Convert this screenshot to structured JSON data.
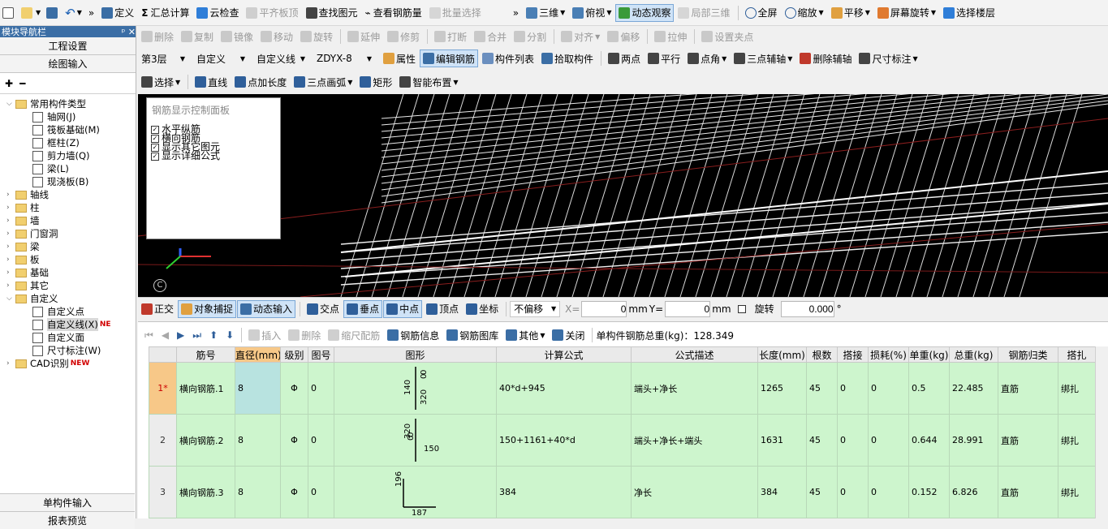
{
  "toolbar1": {
    "items": [
      {
        "label": "定义",
        "icon": "define-icon"
      },
      {
        "label": "汇总计算",
        "icon": "sigma-icon"
      },
      {
        "label": "云检查",
        "icon": "cloud-check-icon"
      },
      {
        "label": "平齐板顶",
        "icon": "align-slab-icon"
      },
      {
        "label": "查找图元",
        "icon": "binoculars-icon"
      },
      {
        "label": "查看钢筋量",
        "icon": "rebar-quantity-icon"
      },
      {
        "label": "批量选择",
        "icon": "batch-select-icon"
      }
    ],
    "right_items": [
      {
        "label": "三维",
        "icon": "3d-cube-icon"
      },
      {
        "label": "俯视",
        "icon": "top-view-icon"
      },
      {
        "label": "动态观察",
        "icon": "orbit-icon"
      },
      {
        "label": "局部三维",
        "icon": "local-3d-icon"
      },
      {
        "label": "全屏",
        "icon": "fullscreen-icon"
      },
      {
        "label": "缩放",
        "icon": "zoom-icon"
      },
      {
        "label": "平移",
        "icon": "pan-icon"
      },
      {
        "label": "屏幕旋转",
        "icon": "screen-rotate-icon"
      },
      {
        "label": "选择楼层",
        "icon": "floor-select-icon"
      }
    ]
  },
  "toolbar2": {
    "items": [
      "删除",
      "复制",
      "镜像",
      "移动",
      "旋转",
      "延伸",
      "修剪",
      "打断",
      "合并",
      "分割",
      "对齐",
      "偏移",
      "拉伸",
      "设置夹点"
    ]
  },
  "toolbar3": {
    "floor": "第3层",
    "type": "自定义",
    "subtype": "自定义线",
    "code": "ZDYX-8",
    "items": [
      "属性",
      "编辑钢筋",
      "构件列表",
      "拾取构件",
      "两点",
      "平行",
      "点角",
      "三点辅轴",
      "删除辅轴",
      "尺寸标注"
    ]
  },
  "toolbar4": {
    "items": [
      "选择",
      "直线",
      "点加长度",
      "三点画弧",
      "矩形",
      "智能布置"
    ]
  },
  "left_panel": {
    "title": "模块导航栏",
    "pin": "ᵖ ✕",
    "project_settings": "工程设置",
    "drawing_input": "绘图输入",
    "tree": [
      {
        "label": "常用构件类型",
        "level": 0,
        "kind": "folder",
        "expanded": true
      },
      {
        "label": "轴网(J)",
        "level": 1,
        "kind": "item"
      },
      {
        "label": "筏板基础(M)",
        "level": 1,
        "kind": "item"
      },
      {
        "label": "框柱(Z)",
        "level": 1,
        "kind": "item"
      },
      {
        "label": "剪力墙(Q)",
        "level": 1,
        "kind": "item"
      },
      {
        "label": "梁(L)",
        "level": 1,
        "kind": "item"
      },
      {
        "label": "现浇板(B)",
        "level": 1,
        "kind": "item"
      },
      {
        "label": "轴线",
        "level": 0,
        "kind": "folder"
      },
      {
        "label": "柱",
        "level": 0,
        "kind": "folder"
      },
      {
        "label": "墙",
        "level": 0,
        "kind": "folder"
      },
      {
        "label": "门窗洞",
        "level": 0,
        "kind": "folder"
      },
      {
        "label": "梁",
        "level": 0,
        "kind": "folder"
      },
      {
        "label": "板",
        "level": 0,
        "kind": "folder"
      },
      {
        "label": "基础",
        "level": 0,
        "kind": "folder"
      },
      {
        "label": "其它",
        "level": 0,
        "kind": "folder"
      },
      {
        "label": "自定义",
        "level": 0,
        "kind": "folder",
        "expanded": true
      },
      {
        "label": "自定义点",
        "level": 1,
        "kind": "item"
      },
      {
        "label": "自定义线(X)",
        "level": 1,
        "kind": "item",
        "badge": "NE",
        "selected": true
      },
      {
        "label": "自定义面",
        "level": 1,
        "kind": "item"
      },
      {
        "label": "尺寸标注(W)",
        "level": 1,
        "kind": "item"
      },
      {
        "label": "CAD识别",
        "level": 0,
        "kind": "folder",
        "badge": "NEW"
      }
    ],
    "single_input": "单构件输入",
    "report": "报表预览"
  },
  "rebar_panel": {
    "title": "钢筋显示控制面板",
    "options": [
      "水平纵筋",
      "横向钢筋",
      "显示其它图元",
      "显示详细公式"
    ]
  },
  "view_corner_label": "C",
  "snap_bar": {
    "items": [
      "正交",
      "对象捕捉",
      "动态输入",
      "交点",
      "垂点",
      "中点",
      "顶点",
      "坐标"
    ],
    "offset_mode": "不偏移",
    "x_label": "X=",
    "x_value": "0",
    "x_unit": "mm",
    "y_label": "Y=",
    "y_value": "0",
    "y_unit": "mm",
    "rotate_label": "旋转",
    "rotate_value": "0.000",
    "degree": "°"
  },
  "rebar_toolbar": {
    "items": [
      "插入",
      "删除",
      "缩尺配筋",
      "钢筋信息",
      "钢筋图库",
      "其他",
      "关闭"
    ],
    "total_label": "单构件钢筋总重(kg)：128.349"
  },
  "rebar_table": {
    "columns": [
      "筋号",
      "直径(mm)",
      "级别",
      "图号",
      "图形",
      "计算公式",
      "公式描述",
      "长度(mm)",
      "根数",
      "搭接",
      "损耗(%)",
      "单重(kg)",
      "总重(kg)",
      "钢筋归类",
      "搭扎"
    ],
    "rows": [
      {
        "rownum": "1*",
        "name": "横向钢筋.1",
        "dia": "8",
        "grade": "Φ",
        "fig": "0",
        "shape": [
          "140",
          "320",
          "0",
          "0"
        ],
        "formula": "40*d+945",
        "desc": "端头+净长",
        "length": "1265",
        "count": "45",
        "lap": "0",
        "loss": "0",
        "unit_w": "0.5",
        "total_w": "22.485",
        "category": "直筋",
        "tie": "绑扎"
      },
      {
        "rownum": "2",
        "name": "横向钢筋.2",
        "dia": "8",
        "grade": "Φ",
        "fig": "0",
        "shape": [
          "150",
          "320",
          "0",
          "0"
        ],
        "formula": "150+1161+40*d",
        "desc": "端头+净长+端头",
        "length": "1631",
        "count": "45",
        "lap": "0",
        "loss": "0",
        "unit_w": "0.644",
        "total_w": "28.991",
        "category": "直筋",
        "tie": "绑扎"
      },
      {
        "rownum": "3",
        "name": "横向钢筋.3",
        "dia": "8",
        "grade": "Φ",
        "fig": "0",
        "shape": [
          "196",
          "187"
        ],
        "formula": "384",
        "desc": "净长",
        "length": "384",
        "count": "45",
        "lap": "0",
        "loss": "0",
        "unit_w": "0.152",
        "total_w": "6.826",
        "category": "直筋",
        "tie": "绑扎"
      }
    ]
  }
}
